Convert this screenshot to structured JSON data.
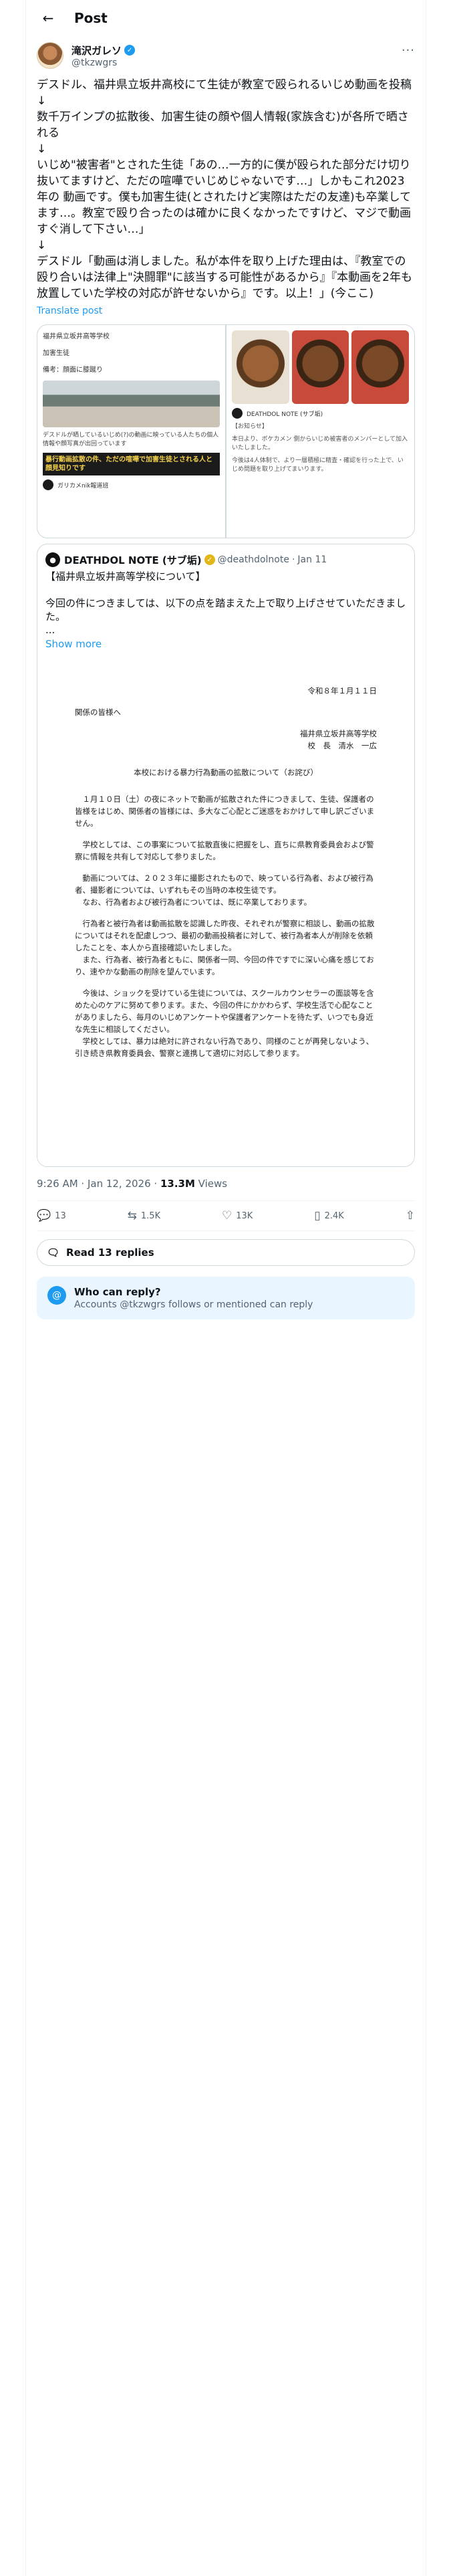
{
  "topbar": {
    "title": "Post"
  },
  "author": {
    "name": "滝沢ガレソ",
    "handle": "@tkzwgrs"
  },
  "tweet": {
    "text": "デスドル、福井県立坂井高校にて生徒が教室で殴られるいじめ動画を投稿\n↓\n数千万インプの拡散後、加害生徒の顔や個人情報(家族含む)が各所で晒される\n↓\nいじめ\"被害者\"とされた生徒「あの…一方的に僕が殴られた部分だけ切り抜いてますけど、ただの喧嘩でいじめじゃないです…」しかもこれ2023年の 動画です。僕も加害生徒(とされたけど実際はただの友達)も卒業してます…。教室で殴り合ったのは確かに良くなかったですけど、マジで動画すぐ消して下さい…」\n↓\nデスドル「動画は消しました。私が本件を取り上げた理由は、『教室での殴り合いは法律上\"決闘罪\"に該当する可能性があるから』『本動画を2年も放置していた学校の対応が許せないから』です。以上！」(今ここ)",
    "translate": "Translate post"
  },
  "media": {
    "left_line1": "福井県立坂井高等学校",
    "left_line2": "加害生徒",
    "left_line3": "備考：顔面に膝蹴り",
    "left_caption": "デスドルが晒しているいじめ(?)の動画に映っている人たちの個人情報や顔写真が出回っています",
    "left_banner": "暴行動画拡散の件、ただの喧嘩で加害生徒とされる人と顔見知りです",
    "left_acct": "ガリカメnik報道班",
    "right_acct_name": "DEATHDOL NOTE (サブ垢)",
    "right_notice": "【お知らせ】",
    "right_text1": "本日より、ボケカメン 側からいじめ被害者のメンバーとして加入いたしました。",
    "right_text2": "今後は4人体制で、より一層積極に精査・確認を行った上で、いじめ問題を取り上げてまいります。"
  },
  "quote": {
    "name": "DEATHDOL NOTE (サブ垢)",
    "handle": "@deathdolnote",
    "date": "Jan 11",
    "text": "【福井県立坂井高等学校について】\n\n今回の件につきましては、以下の点を踏まえた上で取り上げさせていただきました。\n...",
    "show_more": "Show more"
  },
  "doc": {
    "date": "令和８年１月１１日",
    "to": "関係の皆様へ",
    "from1": "福井県立坂井高等学校",
    "from2": "校　長　清水　一広",
    "title": "本校における暴力行為動画の拡散について（お詫び）",
    "p1": "１月１０日（土）の夜にネットで動画が拡散された件につきまして、生徒、保護者の皆様をはじめ、関係者の皆様には、多大なご心配とご迷惑をおかけして申し訳ございません。",
    "p2": "学校としては、この事案について拡散直後に把握をし、直ちに県教育委員会および警察に情報を共有して対応して参りました。",
    "p3": "動画については、２０２３年に撮影されたもので、映っている行為者、および被行為者、撮影者については、いずれもその当時の本校生徒です。",
    "p4": "なお、行為者および被行為者については、既に卒業しております。",
    "p5": "行為者と被行為者は動画拡散を認識した昨夜、それぞれが警察に相談し、動画の拡散についてはそれを配慮しつつ、最初の動画投稿者に対して、被行為者本人が削除を依頼したことを、本人から直接確認いたしました。",
    "p6": "また、行為者、被行為者ともに、関係者一同、今回の件ですでに深い心痛を感じており、速やかな動画の削除を望んでいます。",
    "p7": "今後は、ショックを受けている生徒については、スクールカウンセラーの面談等を含めた心のケアに努めて参ります。また、今回の件にかかわらず、学校生活で心配なことがありましたら、毎月のいじめアンケートや保護者アンケートを待たず、いつでも身近な先生に相談してください。",
    "p8": "学校としては、暴力は絶対に許されない行為であり、同様のことが再発しないよう、引き続き県教育委員会、警察と連携して適切に対応して参ります。"
  },
  "meta": {
    "time": "9:26 AM · Jan 12, 2026 · ",
    "views_count": "13.3M",
    "views_label": " Views"
  },
  "actions": {
    "replies": "13",
    "reposts": "1.5K",
    "likes": "13K",
    "bookmarks": "2.4K"
  },
  "read_replies": "Read 13 replies",
  "can_reply": {
    "title": "Who can reply?",
    "subtitle": "Accounts @tkzwgrs follows or mentioned can reply"
  },
  "colors": {
    "accent": "#1d9bf0",
    "text": "#0f1419",
    "muted": "#536471",
    "border": "#cfd9de"
  }
}
